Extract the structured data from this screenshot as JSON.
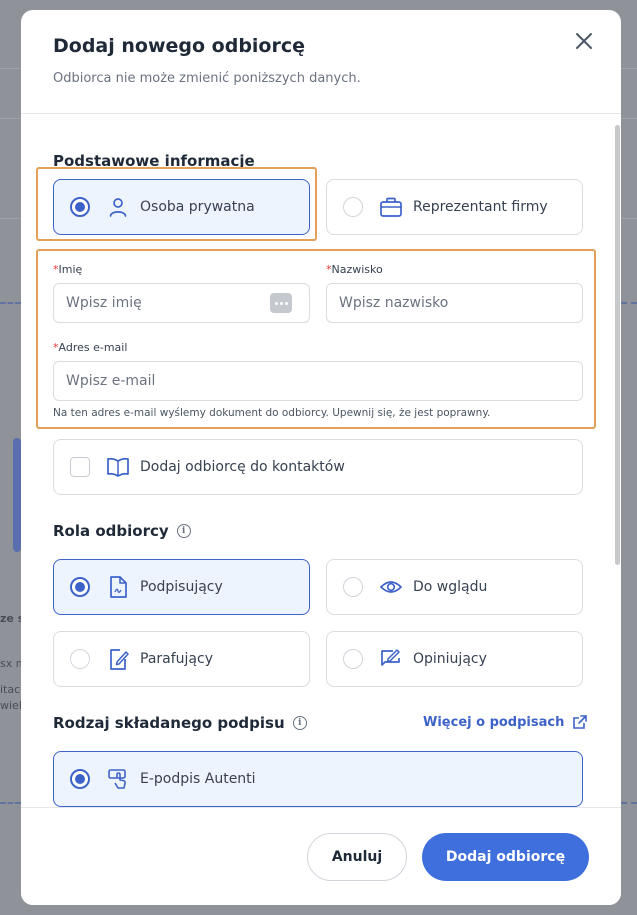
{
  "background": {
    "partial_texts": [
      "ze s",
      "sx m",
      "itac",
      "wiel"
    ]
  },
  "modal": {
    "title": "Dodaj nowego odbiorcę",
    "subtitle": "Odbiorca nie może zmienić poniższych danych.",
    "close_icon": "close-icon"
  },
  "basic_info": {
    "title": "Podstawowe informacje",
    "person_types": [
      {
        "label": "Osoba prywatna",
        "icon": "user-icon",
        "selected": true
      },
      {
        "label": "Reprezentant firmy",
        "icon": "briefcase-icon",
        "selected": false
      }
    ],
    "first_name": {
      "required_mark": "*",
      "label": "Imię",
      "placeholder": "Wpisz imię",
      "value": ""
    },
    "last_name": {
      "required_mark": "*",
      "label": "Nazwisko",
      "placeholder": "Wpisz nazwisko",
      "value": ""
    },
    "email": {
      "required_mark": "*",
      "label": "Adres e-mail",
      "placeholder": "Wpisz e-mail",
      "value": "",
      "hint": "Na ten adres e-mail wyślemy dokument do odbiorcy. Upewnij się, że jest poprawny."
    },
    "add_to_contacts": {
      "label": "Dodaj odbiorcę do kontaktów",
      "checked": false,
      "icon": "book-icon"
    }
  },
  "role": {
    "title": "Rola odbiorcy",
    "options": [
      {
        "label": "Podpisujący",
        "icon": "document-signature-icon",
        "selected": true
      },
      {
        "label": "Do wglądu",
        "icon": "eye-icon",
        "selected": false
      },
      {
        "label": "Parafujący",
        "icon": "document-pen-icon",
        "selected": false
      },
      {
        "label": "Opiniujący",
        "icon": "comment-pen-icon",
        "selected": false
      }
    ]
  },
  "signature_type": {
    "title": "Rodzaj składanego podpisu",
    "link_label": "Więcej o podpisach",
    "options": [
      {
        "label": "E-podpis Autenti",
        "icon": "touch-signature-icon",
        "selected": true
      }
    ]
  },
  "footer": {
    "cancel_label": "Anuluj",
    "submit_label": "Dodaj odbiorcę"
  },
  "colors": {
    "accent": "#3f6fdc",
    "highlight": "#e3a057",
    "required": "#e53935"
  }
}
